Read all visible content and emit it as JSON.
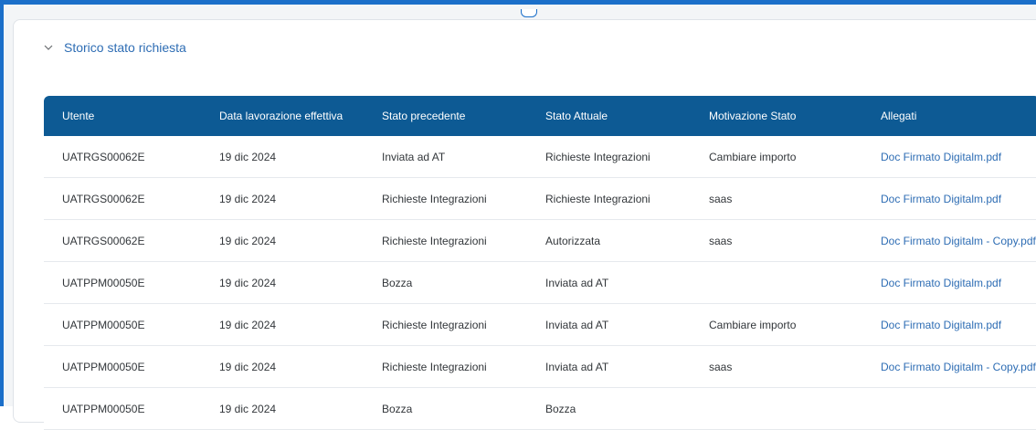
{
  "section": {
    "title": "Storico stato richiesta",
    "toggle_icon": "chevron-down-icon"
  },
  "table": {
    "columns": [
      "Utente",
      "Data lavorazione effettiva",
      "Stato precedente",
      "Stato Attuale",
      "Motivazione Stato",
      "Allegati"
    ],
    "rows": [
      [
        "UATRGS00062E",
        "19 dic 2024",
        "Inviata ad AT",
        "Richieste Integrazioni",
        "Cambiare importo",
        "Doc Firmato Digitalm.pdf"
      ],
      [
        "UATRGS00062E",
        "19 dic 2024",
        "Richieste Integrazioni",
        "Richieste Integrazioni",
        "saas",
        "Doc Firmato Digitalm.pdf"
      ],
      [
        "UATRGS00062E",
        "19 dic 2024",
        "Richieste Integrazioni",
        "Autorizzata",
        "saas",
        "Doc Firmato Digitalm - Copy.pdf"
      ],
      [
        "UATPPM00050E",
        "19 dic 2024",
        "Bozza",
        "Inviata ad AT",
        "",
        "Doc Firmato Digitalm.pdf"
      ],
      [
        "UATPPM00050E",
        "19 dic 2024",
        "Richieste Integrazioni",
        "Inviata ad AT",
        "Cambiare importo",
        "Doc Firmato Digitalm.pdf"
      ],
      [
        "UATPPM00050E",
        "19 dic 2024",
        "Richieste Integrazioni",
        "Inviata ad AT",
        "saas",
        "Doc Firmato Digitalm - Copy.pdf"
      ],
      [
        "UATPPM00050E",
        "19 dic 2024",
        "Bozza",
        "Bozza",
        "",
        ""
      ]
    ]
  },
  "colors": {
    "header_bg": "#0d5a94",
    "link": "#2e6db4",
    "frame_accent": "#1b6fc9"
  }
}
